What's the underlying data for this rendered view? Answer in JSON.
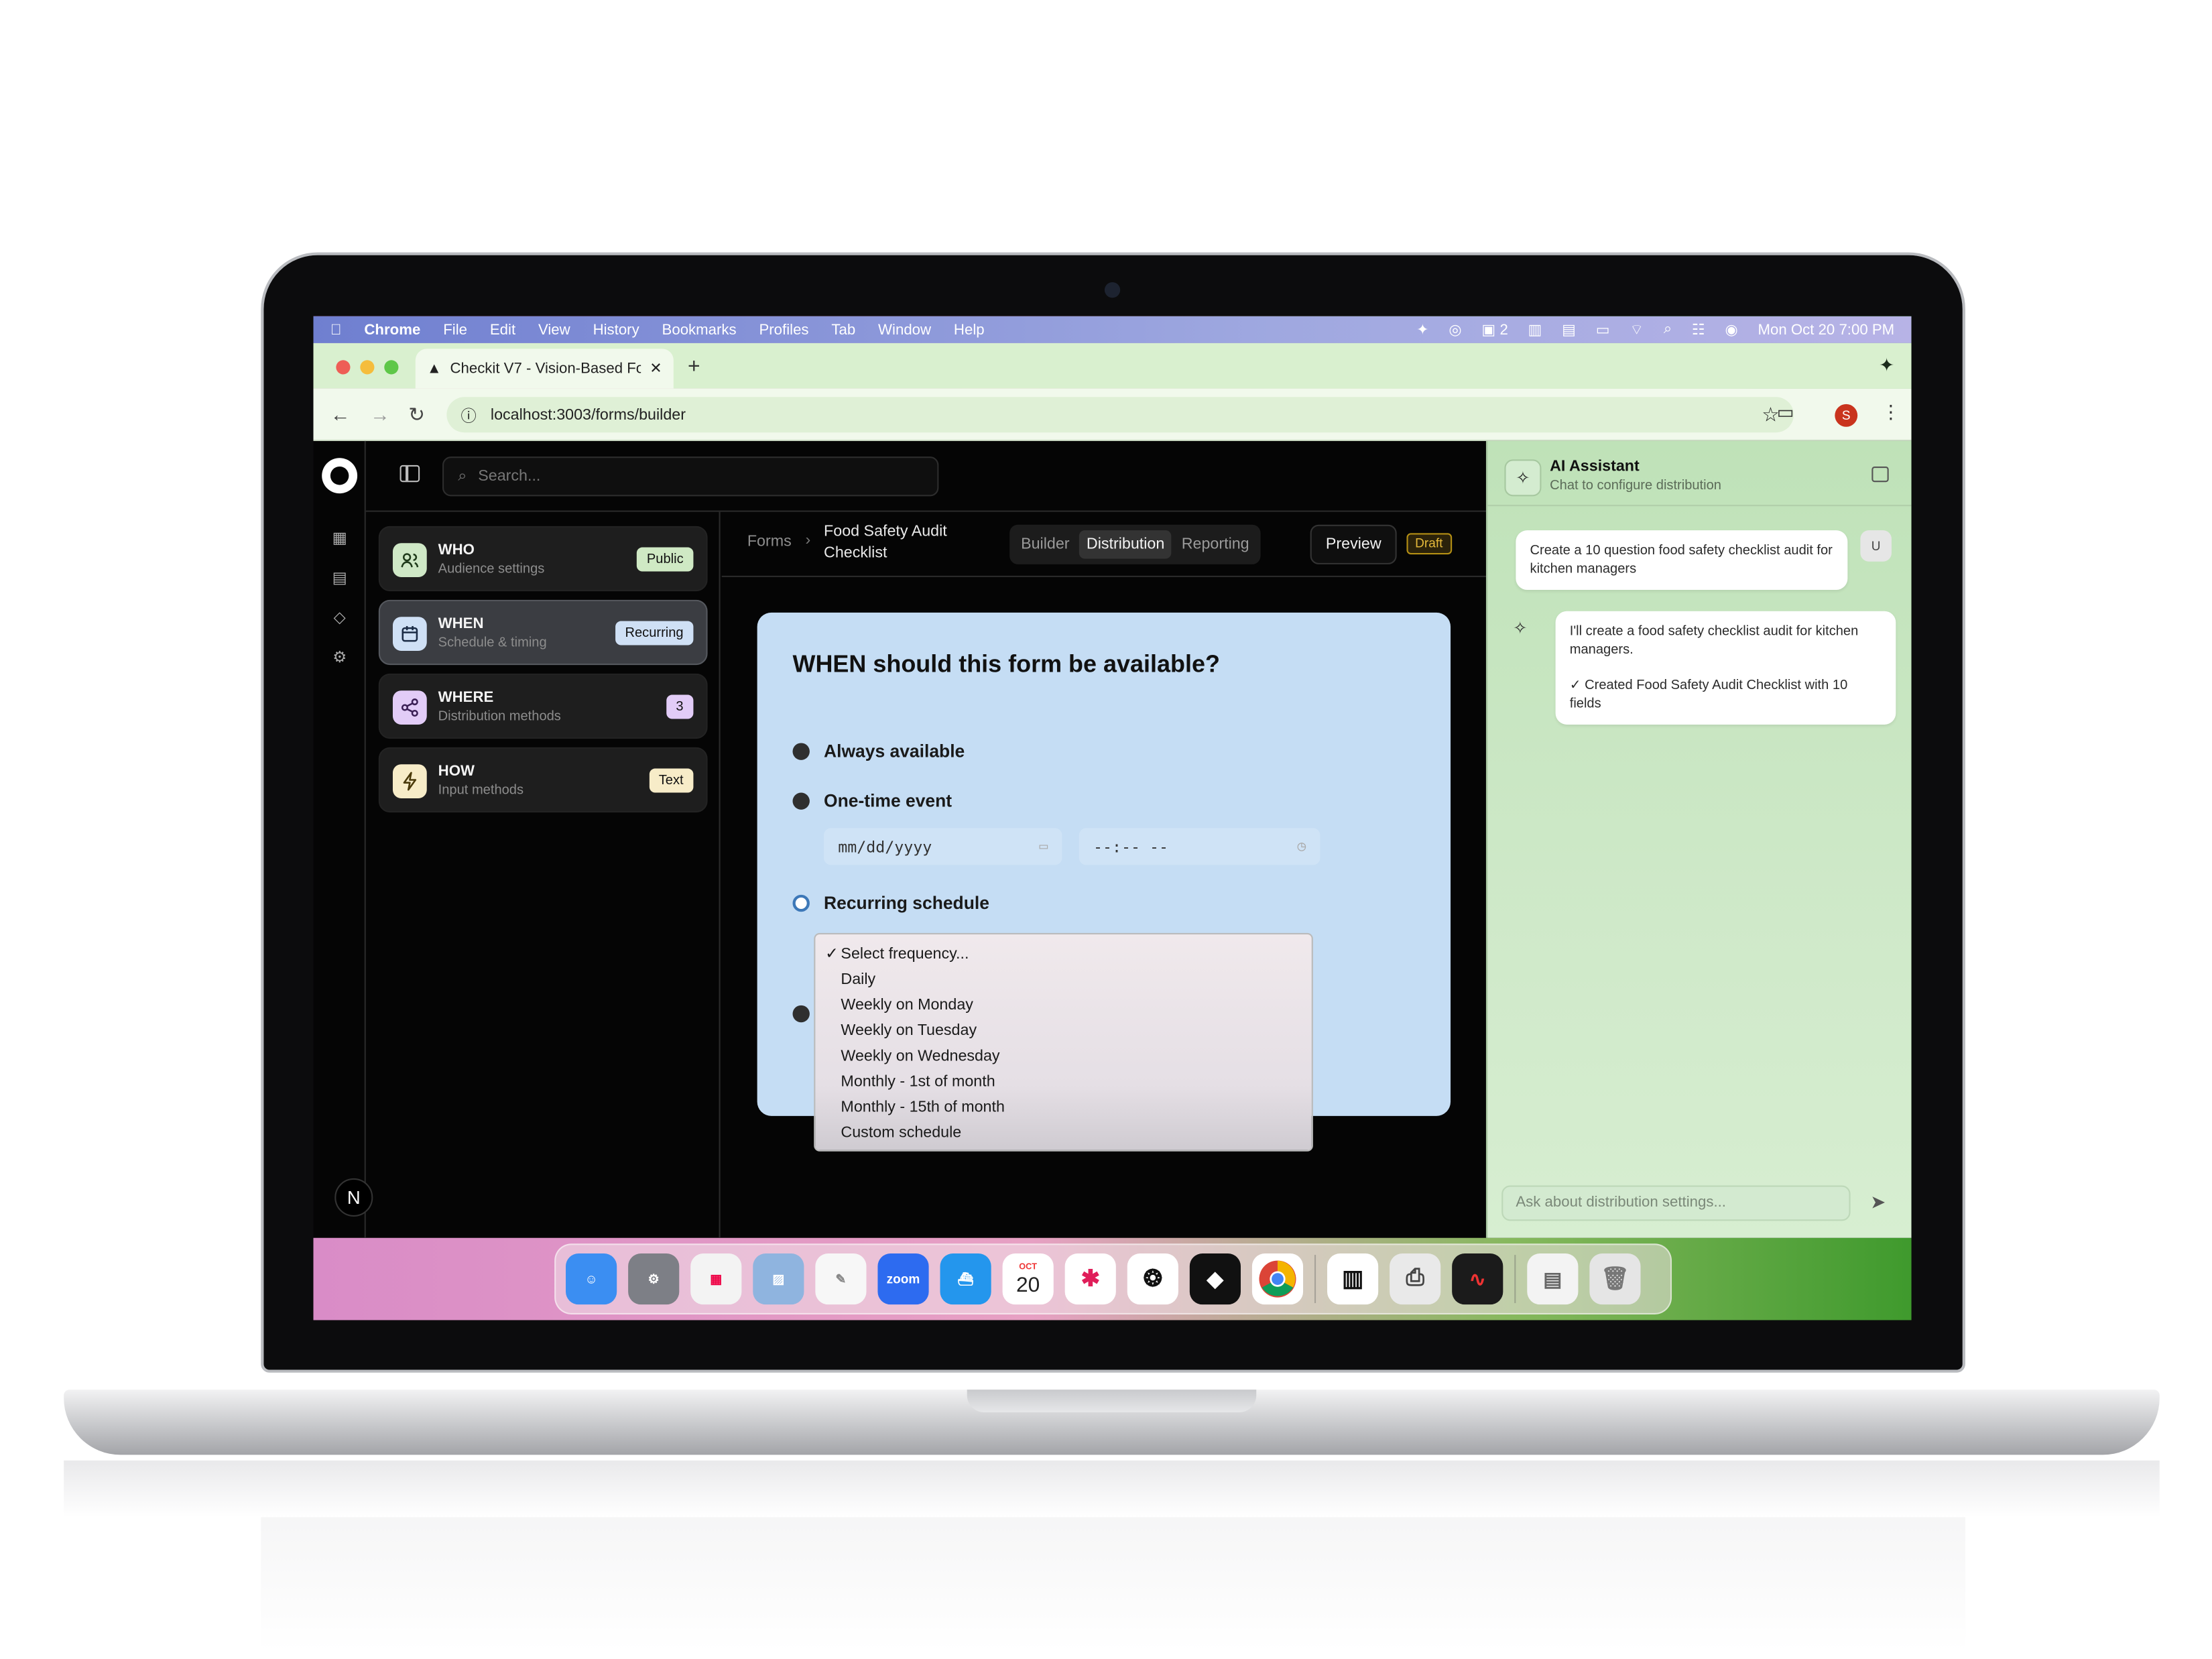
{
  "menubar": {
    "app": "Chrome",
    "items": [
      "File",
      "Edit",
      "View",
      "History",
      "Bookmarks",
      "Profiles",
      "Tab",
      "Window",
      "Help"
    ],
    "badge_count": "2",
    "datetime": "Mon Oct 20  7:00 PM"
  },
  "browser": {
    "tab_title": "Checkit V7 - Vision-Based Fo",
    "url": "localhost:3003/forms/builder",
    "profile_initial": "S"
  },
  "app": {
    "search_placeholder": "Search...",
    "steps": [
      {
        "title": "WHO",
        "subtitle": "Audience settings",
        "badge": "Public",
        "badge_color": "#cfe9c4",
        "icon_bg": "#cfe8c6"
      },
      {
        "title": "WHEN",
        "subtitle": "Schedule & timing",
        "badge": "Recurring",
        "badge_color": "#cfe0f5",
        "icon_bg": "#cfe0f5"
      },
      {
        "title": "WHERE",
        "subtitle": "Distribution methods",
        "badge": "3",
        "badge_color": "#e2ccf7",
        "icon_bg": "#e2ccf7"
      },
      {
        "title": "HOW",
        "subtitle": "Input methods",
        "badge": "Text",
        "badge_color": "#f7ecc8",
        "icon_bg": "#f7ecc8"
      }
    ],
    "breadcrumb": {
      "root": "Forms",
      "page": "Food Safety Audit Checklist"
    },
    "tabs": [
      "Builder",
      "Distribution",
      "Reporting"
    ],
    "active_tab": "Distribution",
    "preview": "Preview",
    "status": "Draft",
    "n_logo": "N"
  },
  "when_card": {
    "title": "WHEN should this form be available?",
    "options": [
      "Always available",
      "One-time event",
      "Recurring schedule"
    ],
    "selected_option": "Recurring schedule",
    "date_placeholder": "mm/dd/yyyy",
    "time_placeholder": "--:-- --",
    "frequency_options": [
      "Select frequency...",
      "Daily",
      "Weekly on Monday",
      "Weekly on Tuesday",
      "Weekly on Wednesday",
      "Monthly - 1st of month",
      "Monthly - 15th of month",
      "Custom schedule"
    ],
    "frequency_checked": "Select frequency..."
  },
  "ai_panel": {
    "title": "AI Assistant",
    "subtitle": "Chat to configure distribution",
    "user_initial": "U",
    "user_message": "Create a 10 question food safety checklist audit for kitchen managers",
    "bot_message_1": "I'll create a food safety checklist audit for kitchen managers.",
    "bot_message_2": "✓ Created Food Safety Audit Checklist with 10 fields",
    "input_placeholder": "Ask about distribution settings..."
  },
  "dock": {
    "apps": [
      {
        "name": "finder",
        "color": "#3b8ef2"
      },
      {
        "name": "system-settings",
        "color": "#7d7f86"
      },
      {
        "name": "launchpad",
        "color": "#f3f3f3"
      },
      {
        "name": "preview",
        "color": "#8fb4df"
      },
      {
        "name": "textedit",
        "color": "#f7f7f7"
      },
      {
        "name": "zoom",
        "color": "#2d6bf0"
      },
      {
        "name": "docker",
        "color": "#2496ed"
      },
      {
        "name": "calendar",
        "color": "#ffffff"
      },
      {
        "name": "slack",
        "color": "#ffffff"
      },
      {
        "name": "chatgpt",
        "color": "#ffffff"
      },
      {
        "name": "cursor",
        "color": "#111111"
      },
      {
        "name": "chrome",
        "color": "#ffffff"
      },
      {
        "name": "zebra",
        "color": "#ffffff"
      },
      {
        "name": "printer",
        "color": "#e9e9e9"
      },
      {
        "name": "voice-memos",
        "color": "#1b1b1b"
      },
      {
        "name": "downloads",
        "color": "#f3f3f3"
      },
      {
        "name": "trash",
        "color": "#e5e5e5"
      }
    ],
    "zoom_label": "zoom",
    "calendar_month": "OCT",
    "calendar_day": "20"
  }
}
